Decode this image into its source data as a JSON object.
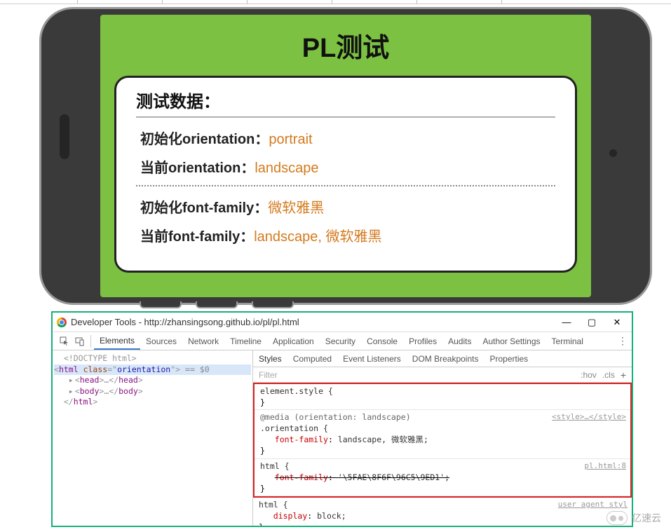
{
  "phone": {
    "title": "PL测试",
    "sectionHeader": "测试数据：",
    "rows": [
      {
        "label": "初始化orientation：",
        "value": "portrait"
      },
      {
        "label": "当前orientation：",
        "value": "landscape"
      },
      {
        "label": "初始化font-family：",
        "value": "微软雅黑"
      },
      {
        "label": "当前font-family：",
        "value": "landscape, 微软雅黑"
      }
    ]
  },
  "devtools": {
    "title": "Developer Tools - http://zhansingsong.github.io/pl/pl.html",
    "mainTabs": [
      "Elements",
      "Sources",
      "Network",
      "Timeline",
      "Application",
      "Security",
      "Console",
      "Profiles",
      "Audits",
      "Author Settings",
      "Terminal"
    ],
    "activeMainTab": "Elements",
    "dom": {
      "doctype": "<!DOCTYPE html>",
      "htmlOpen": {
        "tag": "html",
        "attrName": "class",
        "attrVal": "orientation",
        "suffix": " == $0"
      },
      "head": "<head>…</head>",
      "body": "<body>…</body>",
      "htmlClose": "</html>"
    },
    "sideTabs": [
      "Styles",
      "Computed",
      "Event Listeners",
      "DOM Breakpoints",
      "Properties"
    ],
    "activeSideTab": "Styles",
    "filterPlaceholder": "Filter",
    "hov": ":hov",
    "cls": ".cls",
    "rules": {
      "element": {
        "selector": "element.style {",
        "close": "}"
      },
      "media": {
        "query": "@media (orientation: landscape)",
        "selector": ".orientation {",
        "prop": "font-family",
        "val": "landscape, 微软雅黑;",
        "close": "}",
        "source": "<style>…</style>"
      },
      "html1": {
        "selector": "html {",
        "prop": "font-family",
        "val": "'\\5FAE\\8F6F\\96C5\\9ED1';",
        "close": "}",
        "source": "pl.html:8"
      },
      "html2": {
        "selector": "html {",
        "prop": "display",
        "val": "block;",
        "close": "}",
        "source": "user agent styl"
      }
    }
  },
  "watermark": "亿速云"
}
